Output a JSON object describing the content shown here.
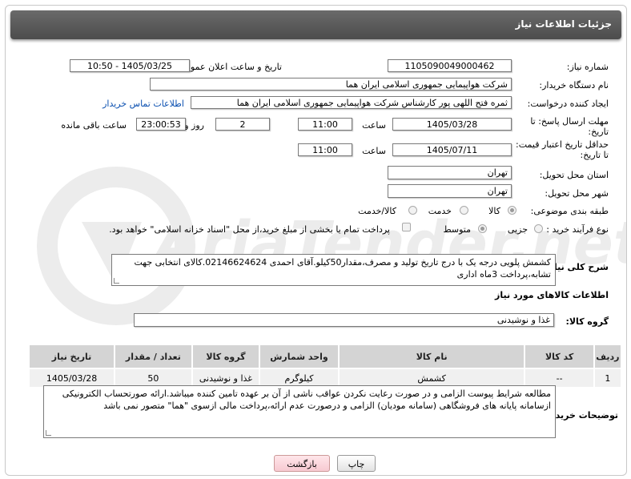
{
  "window_title": "جزئیات اطلاعات نیاز",
  "fields": {
    "need_number_label": "شماره نیاز:",
    "need_number": "1105090049000462",
    "announce_label": "تاریخ و ساعت اعلان عمومی:",
    "announce_value": "1405/03/25 - 10:50",
    "buyer_org_label": "نام دستگاه خریدار:",
    "buyer_org": "شرکت هواپیمایی جمهوری اسلامی ایران هما",
    "creator_label": "ایجاد کننده درخواست:",
    "creator": "ثمره فتح اللهی پور کارشناس شرکت هواپیمایی جمهوری اسلامی ایران هما",
    "contact_link": "اطلاعات تماس خریدار",
    "deadline_label_1": "مهلت ارسال پاسخ: تا",
    "deadline_label_2": "تاریخ:",
    "deadline_date": "1405/03/28",
    "hour_label": "ساعت",
    "deadline_time": "11:00",
    "days_value": "2",
    "days_label": "روز و",
    "remaining_value": "23:00:53",
    "remaining_label": "ساعت باقی مانده",
    "price_validity_label_1": "حداقل تاریخ اعتبار قیمت:",
    "price_validity_label_2": "تا تاریخ:",
    "price_date": "1405/07/11",
    "price_time": "11:00",
    "province_label": "استان محل تحویل:",
    "province": "تهران",
    "city_label": "شهر محل تحویل:",
    "city": "تهران",
    "category_label": "طبقه بندی موضوعی:",
    "category_options": [
      "کالا",
      "خدمت",
      "کالا/خدمت"
    ],
    "process_label": "نوع فرآیند خرید :",
    "process_options": [
      "جزیی",
      "متوسط"
    ],
    "payment_note": "پرداخت تمام یا بخشی از مبلغ خرید،از محل \"اسناد خزانه اسلامی\" خواهد بود."
  },
  "description": {
    "label": "شرح کلی نیاز:",
    "text": "کشمش پلویی درجه یک با درج تاریخ تولید و مصرف،مقدار50کیلو.آقای احمدی 02146624624.کالای انتخابی جهت تشابه،پرداخت 3ماه اداری"
  },
  "goods_info_label": "اطلاعات کالاهای مورد نیاز",
  "goods_group": {
    "label": "گروه کالا:",
    "value": "غذا و نوشیدنی"
  },
  "table": {
    "headers": [
      "ردیف",
      "کد کالا",
      "نام کالا",
      "واحد شمارش",
      "گروه کالا",
      "تعداد / مقدار",
      "تاریخ نیاز"
    ],
    "rows": [
      [
        "1",
        "--",
        "کشمش",
        "کیلوگرم",
        "غذا و نوشیدنی",
        "50",
        "1405/03/28"
      ]
    ]
  },
  "buyer_notes": {
    "label": "توضیحات خریدار:",
    "text": "مطالعه شرایط پیوست الزامی و در صورت رعایت نکردن عواقب ناشی از آن بر عهده تامین کننده میباشد.ارائه صورتحساب الکترونیکی ازسامانه پایانه های فروشگاهی (سامانه مودیان) الزامی و درصورت عدم ارائه،پرداخت مالی ازسوی \"هما\" متصور نمی باشد"
  },
  "buttons": {
    "print": "چاپ",
    "back": "بازگشت"
  },
  "watermark_text": "AriaTender.net",
  "colors": {
    "titlebar": "#555555",
    "link": "#0a4fb0",
    "watermark": "#e9e9e9",
    "table_header": "#d4d4d4"
  }
}
